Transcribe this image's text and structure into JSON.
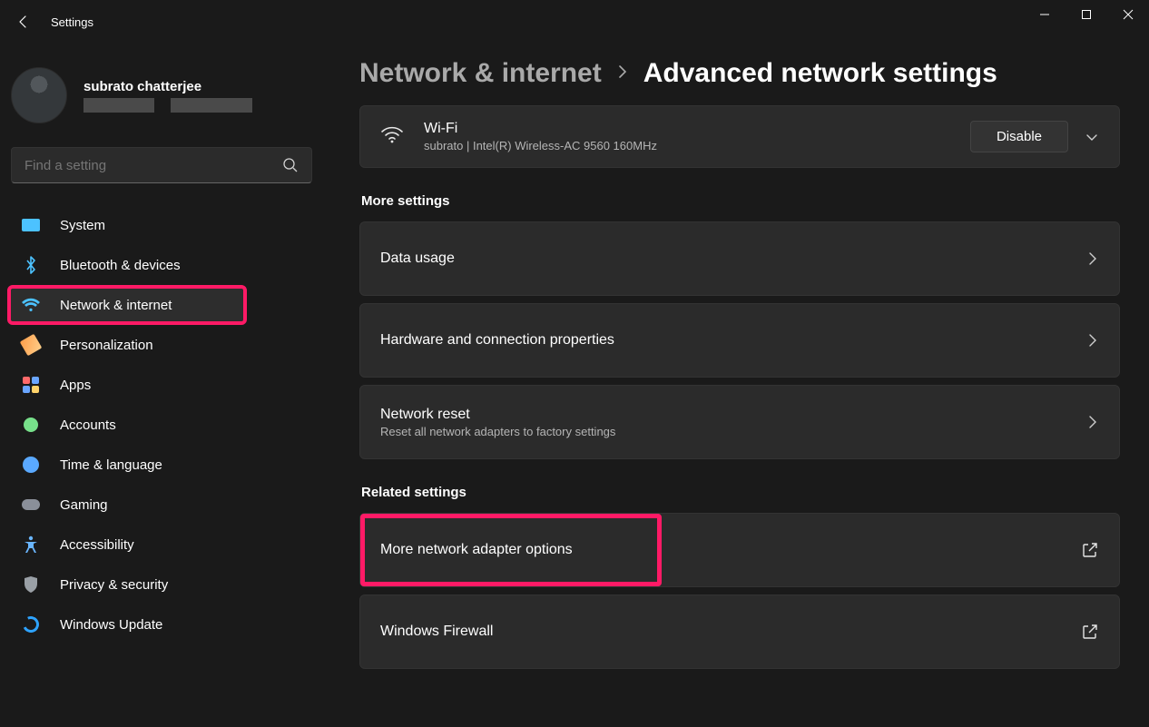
{
  "window": {
    "title": "Settings"
  },
  "profile": {
    "name": "subrato chatterjee"
  },
  "search": {
    "placeholder": "Find a setting"
  },
  "sidebar": {
    "items": [
      {
        "label": "System"
      },
      {
        "label": "Bluetooth & devices"
      },
      {
        "label": "Network & internet"
      },
      {
        "label": "Personalization"
      },
      {
        "label": "Apps"
      },
      {
        "label": "Accounts"
      },
      {
        "label": "Time & language"
      },
      {
        "label": "Gaming"
      },
      {
        "label": "Accessibility"
      },
      {
        "label": "Privacy & security"
      },
      {
        "label": "Windows Update"
      }
    ]
  },
  "breadcrumb": {
    "parent": "Network & internet",
    "current": "Advanced network settings"
  },
  "wifi": {
    "title": "Wi-Fi",
    "detail": "subrato | Intel(R) Wireless-AC 9560 160MHz",
    "action": "Disable"
  },
  "more_settings": {
    "header": "More settings",
    "items": [
      {
        "title": "Data usage",
        "sub": ""
      },
      {
        "title": "Hardware and connection properties",
        "sub": ""
      },
      {
        "title": "Network reset",
        "sub": "Reset all network adapters to factory settings"
      }
    ]
  },
  "related": {
    "header": "Related settings",
    "items": [
      {
        "title": "More network adapter options"
      },
      {
        "title": "Windows Firewall"
      }
    ]
  }
}
